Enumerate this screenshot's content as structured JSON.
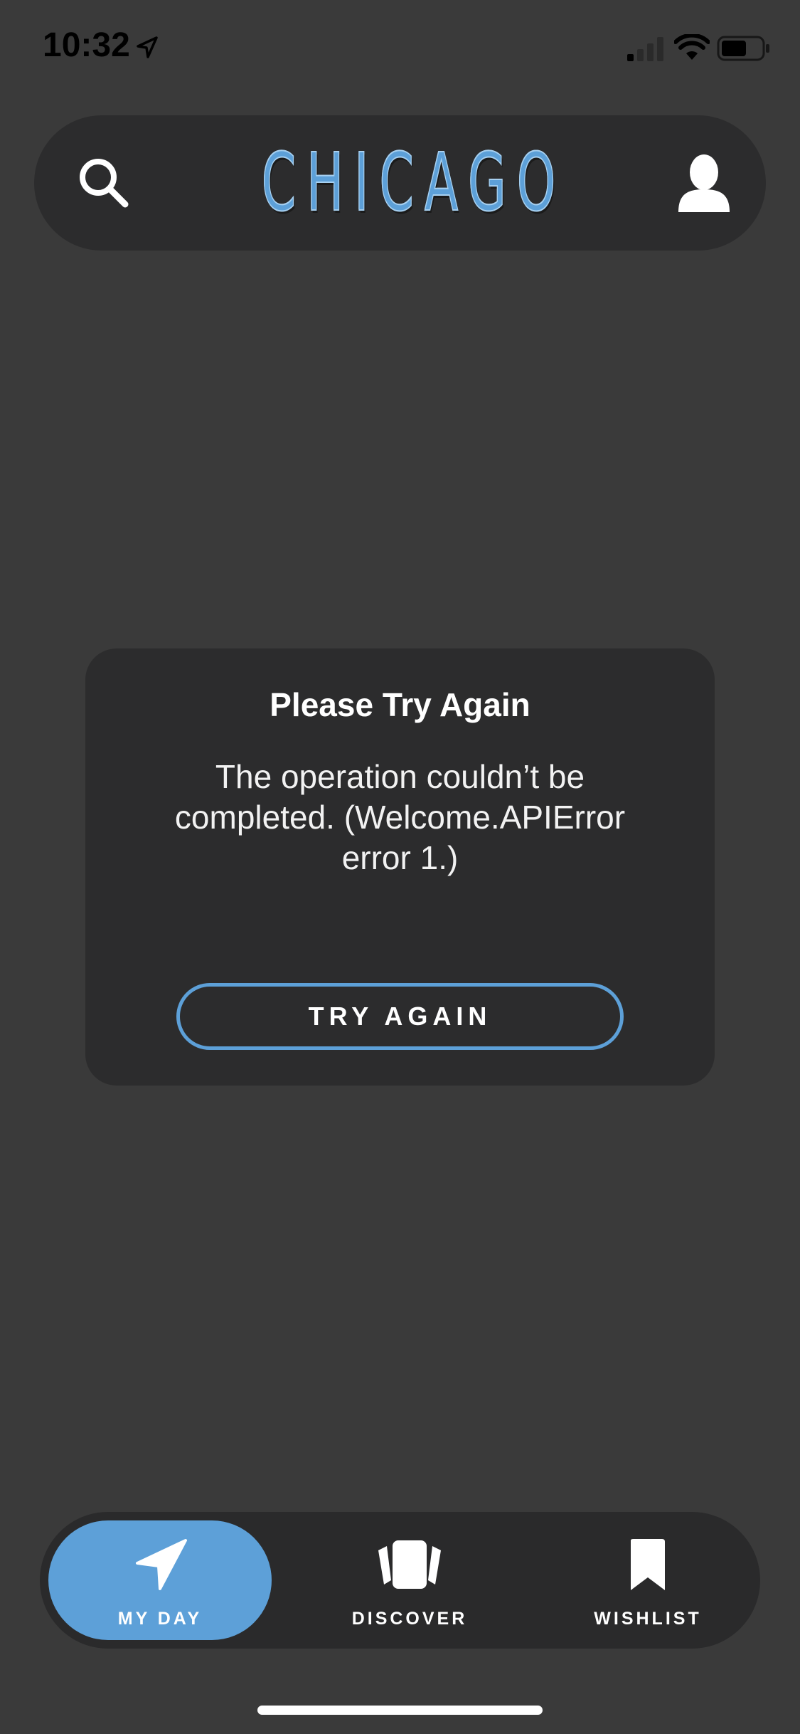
{
  "status_bar": {
    "time": "10:32",
    "icons": [
      "location-arrow-icon",
      "cellular-signal-icon",
      "wifi-icon",
      "battery-icon"
    ]
  },
  "header": {
    "title": "CHICAGO",
    "left_icon": "search-icon",
    "right_icon": "profile-icon"
  },
  "error_card": {
    "title": "Please Try Again",
    "message": "The operation couldn’t be completed. (Welcome.APIError error 1.)",
    "button_label": "TRY AGAIN"
  },
  "tab_bar": {
    "active_tab": "MY DAY",
    "tabs": [
      {
        "label": "MY DAY",
        "icon": "navigation-arrow-icon"
      },
      {
        "label": "DISCOVER",
        "icon": "cards-icon"
      },
      {
        "label": "WISHLIST",
        "icon": "bookmark-icon"
      }
    ]
  },
  "colors": {
    "background": "#3a3a3a",
    "surface": "#2c2c2d",
    "accent": "#5da0d8",
    "text": "#ffffff"
  }
}
